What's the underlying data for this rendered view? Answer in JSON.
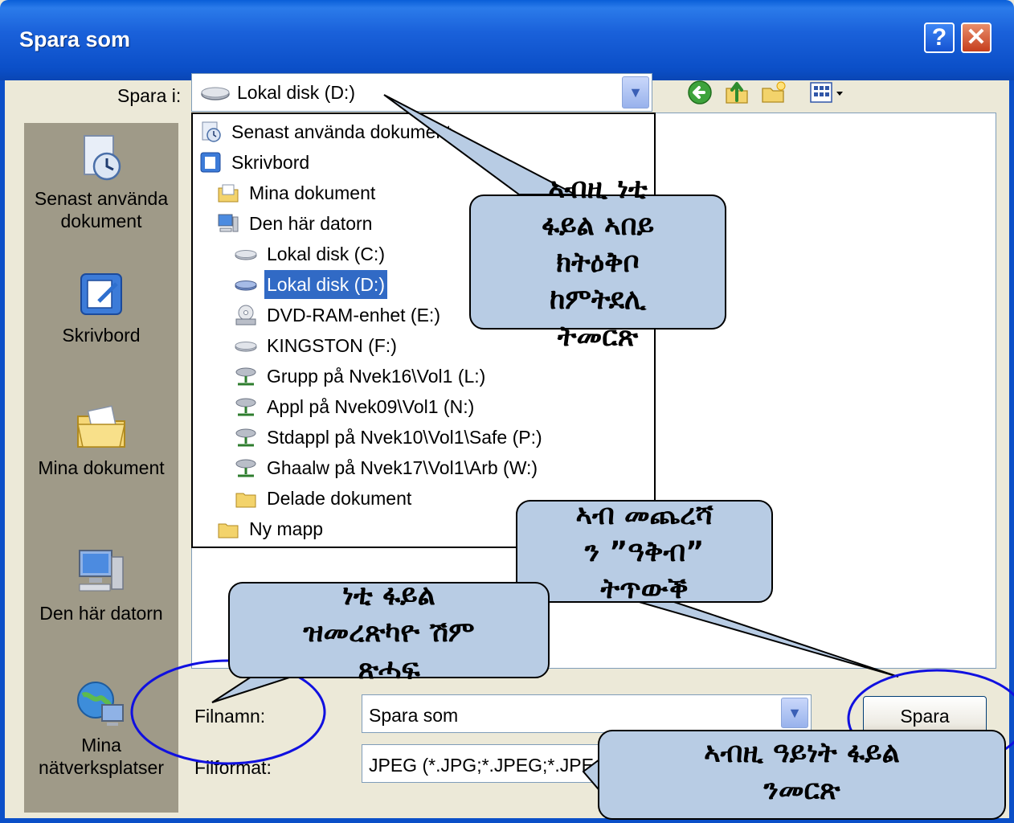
{
  "window": {
    "title": "Spara som",
    "help_label": "?",
    "close_label": "✕"
  },
  "save_in": {
    "label": "Spara i:",
    "value": "Lokal disk (D:)",
    "icon": "drive-icon"
  },
  "toolbar": {
    "back": "back-icon",
    "up": "up-folder-icon",
    "new_folder": "new-folder-icon",
    "views": "views-menu-icon"
  },
  "places": [
    {
      "label": "Senast använda dokument",
      "icon": "recent-documents-icon"
    },
    {
      "label": "Skrivbord",
      "icon": "desktop-icon"
    },
    {
      "label": "Mina dokument",
      "icon": "my-documents-icon"
    },
    {
      "label": "Den här datorn",
      "icon": "my-computer-icon"
    },
    {
      "label": "Mina nätverksplatser",
      "icon": "network-places-icon"
    }
  ],
  "location_list": [
    {
      "label": "Senast använda dokument",
      "icon": "recent-icon",
      "selected": false
    },
    {
      "label": "Skrivbord",
      "icon": "desktop-icon",
      "selected": false
    },
    {
      "label": "Mina dokument",
      "icon": "folder-icon",
      "selected": false
    },
    {
      "label": "Den här datorn",
      "icon": "computer-icon",
      "selected": false
    },
    {
      "label": "Lokal disk (C:)",
      "icon": "drive-icon",
      "selected": false
    },
    {
      "label": "Lokal disk (D:)",
      "icon": "drive-icon",
      "selected": true
    },
    {
      "label": "DVD-RAM-enhet (E:)",
      "icon": "dvd-icon",
      "selected": false
    },
    {
      "label": "KINGSTON (F:)",
      "icon": "drive-icon",
      "selected": false
    },
    {
      "label": "Grupp på Nvek16\\Vol1 (L:)",
      "icon": "network-drive-icon",
      "selected": false
    },
    {
      "label": "Appl på Nvek09\\Vol1 (N:)",
      "icon": "network-drive-icon",
      "selected": false
    },
    {
      "label": "Stdappl på Nvek10\\Vol1\\Safe (P:)",
      "icon": "network-drive-icon",
      "selected": false
    },
    {
      "label": "Ghaalw på Nvek17\\Vol1\\Arb (W:)",
      "icon": "network-drive-icon",
      "selected": false
    },
    {
      "label": "Delade dokument",
      "icon": "folder-icon",
      "selected": false
    },
    {
      "label": "Ny mapp",
      "icon": "folder-icon",
      "selected": false
    }
  ],
  "filename": {
    "label": "Filnamn:",
    "value": "Spara som"
  },
  "fileformat": {
    "label": "Filformat:",
    "value": "JPEG (*.JPG;*.JPEG;*.JPE;*.JFIF)"
  },
  "save_button": "Spara",
  "callouts": {
    "save_location": [
      "ኣብዚ ነቲ",
      "ፋይል ኣበይ",
      "ክትዕቅቦ",
      "ከምትደሊ",
      "ትመርጽ"
    ],
    "save_press": [
      "ኣብ መጨረሻ",
      "ን ”ዓቅብ”",
      "ትጥውቕ"
    ],
    "file_name": [
      "ነቲ ፋይል",
      "ዝመረጽካዮ ሽም",
      "ጽሓፍ"
    ],
    "file_type": [
      "ኣብዚ ዓይነት ፋይል",
      "ንመርጽ"
    ]
  },
  "colors": {
    "titlebar": "#0B4FC8",
    "selection": "#316AC5",
    "callout_fill": "#B8CCE4",
    "highlight_ellipse": "#1010E0"
  }
}
